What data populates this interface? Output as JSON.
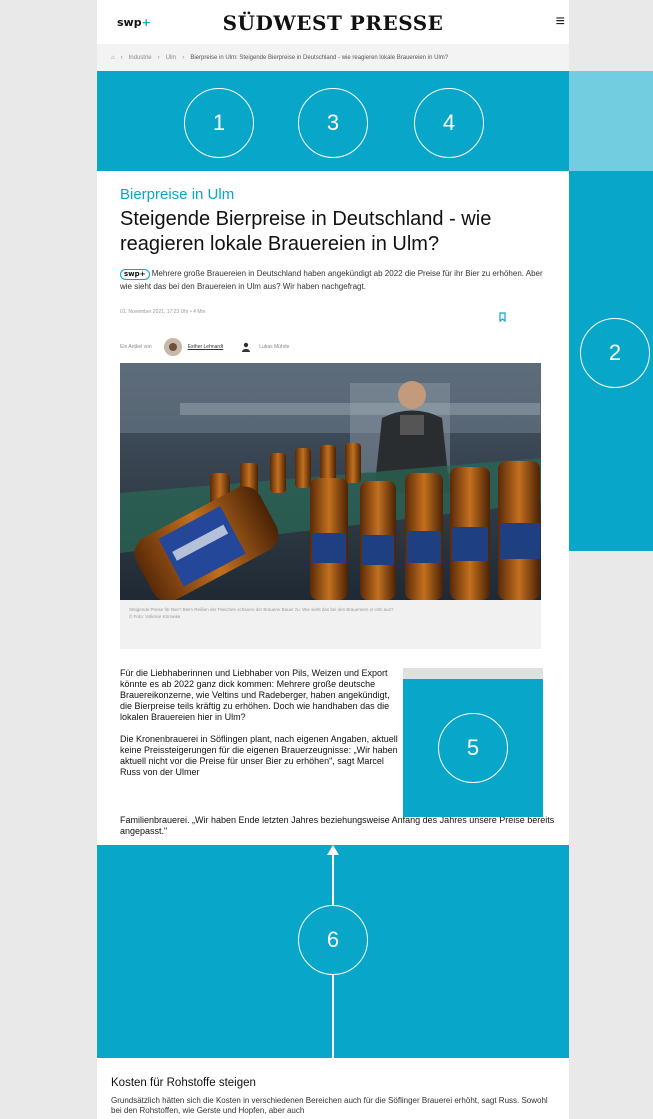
{
  "header": {
    "logo_small": "swp",
    "logo_plus": "+",
    "site_title": "SÜDWEST PRESSE",
    "menu_icon": "hamburger-menu-icon"
  },
  "breadcrumb": {
    "items": [
      "Industrie",
      "Ulm"
    ],
    "current": "Bierpreise in Ulm: Steigende Bierpreise in Deutschland - wie reagieren lokale Brauereien in Ulm?"
  },
  "ad_zones": {
    "zone_1": "1",
    "zone_2": "2",
    "zone_3": "3",
    "zone_4": "4",
    "zone_5": "5",
    "zone_6": "6"
  },
  "article": {
    "kicker": "Bierpreise in Ulm",
    "headline": "Steigende Bierpreise in Deutschland - wie reagieren lokale Brauereien in Ulm?",
    "teaser_badge": "swp+",
    "teaser": "Mehrere große Brauereien in Deutschland haben angekündigt ab 2022 die Preise für ihr Bier zu erhöhen. Aber wie sieht das bei den Brauereien in Ulm aus? Wir haben nachgefragt.",
    "dateline": "01. November 2021, 17:23 Uhr  •  4 Min",
    "author_prefix": "Ein Artikel von",
    "author_name": "Esther Lehnardt",
    "photographer": "Lukas Mührle",
    "caption_line1": "Steigende Preise für Bier? Beim Reißen der Flaschen schauen der Brauerei Bauer zu. Wie sieht das bei den Brauereien in Ulm aus?",
    "caption_line2": "© Foto: Volkmar Könneke",
    "paragraph_1": "Für die Liebhaberinnen und Liebhaber von Pils, Weizen und Export könnte es ab 2022 ganz dick kommen: Mehrere große deutsche Brauereikonzerne, wie Veltins und Radeberger, haben angekündigt, die Bierpreise teils kräftig zu erhöhen. Doch wie handhaben das die lokalen Brauereien hier in Ulm?",
    "paragraph_2a": "Die Kronenbrauerei in Söflingen plant, nach eigenen Angaben, aktuell keine Preissteigerungen für die eigenen Brauerzeugnisse: „Wir haben aktuell nicht vor die Preise für unser Bier zu erhöhen\", sagt Marcel Russ von der Ulmer",
    "paragraph_2b": "Familienbrauerei. „Wir haben Ende letzten Jahres beziehungsweise Anfang des Jahres unsere Preise bereits angepasst.\""
  },
  "section": {
    "title": "Kosten für Rohstoffe steigen",
    "text": "Grundsätzlich hätten sich die Kosten in verschiedenen Bereichen auch für die Söflinger Brauerei erhöht, sagt Russ. Sowohl bei den Rohstoffen, wie Gerste und Hopfen, aber auch"
  },
  "colors": {
    "ad_blue": "#08a6c8",
    "ad_light_blue": "#72cde0",
    "accent": "#0aa5c9",
    "background": "#e9e9e9"
  }
}
